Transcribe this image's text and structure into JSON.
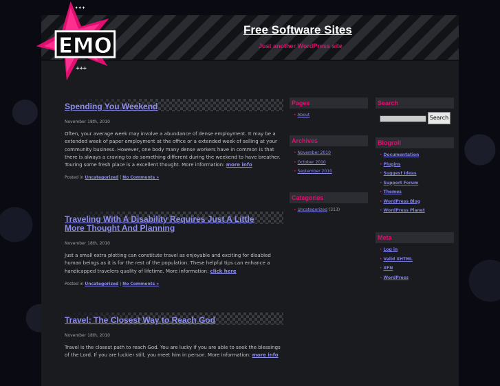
{
  "header": {
    "site_title": "Free Software Sites",
    "site_description": "Just another WordPress site",
    "logo_text": "EMO"
  },
  "posts": [
    {
      "title": "Spending You Weekend",
      "date": "November 18th, 2010",
      "body": "Often, your average week may involve a abundance of dense employment. It may be a extended week of paper employment at the office or a extended week of selling at your community business. However, one body many dense workers have in common is that there is always a craving to do something different during the weekend to have breather. Touring some fresh place is a excellent thought. More information: ",
      "more_link": "more info",
      "posted_in": "Posted in ",
      "category": "Uncategorized",
      "separator": " | ",
      "comments": "No Comments »"
    },
    {
      "title": "Traveling With A Disability Requires Just A Little More Thought And Planning",
      "date": "November 18th, 2010",
      "body": "Just a small extra plotting can constitute travel as enjoyable and exciting for disabled human beings as it is for the rest of the population. These helpful tips can enhance a handicapped travelers quality of lifetime. More information: ",
      "more_link": "click here",
      "posted_in": "Posted in ",
      "category": "Uncategorized",
      "separator": " | ",
      "comments": "No Comments »"
    },
    {
      "title": "Travel: The Closest Way to Reach God",
      "date": "November 18th, 2010",
      "body": "Travel is the closest path to reach God. You are lucky if you are able to seek the blessings of the Lord. If you are luckier still, you meet him in person. More information: ",
      "more_link": "more info"
    }
  ],
  "sidebar_left": {
    "pages": {
      "heading": "Pages",
      "items": [
        "About"
      ]
    },
    "archives": {
      "heading": "Archives",
      "items": [
        "November 2010",
        "October 2010",
        "September 2010"
      ]
    },
    "categories": {
      "heading": "Categories",
      "item": "Uncategorized",
      "count": "(313)"
    }
  },
  "sidebar_right": {
    "search": {
      "heading": "Search",
      "button": "Search",
      "value": ""
    },
    "blogroll": {
      "heading": "Blogroll",
      "items": [
        "Documentation",
        "Plugins",
        "Suggest Ideas",
        "Support Forum",
        "Themes",
        "WordPress Blog",
        "WordPress Planet"
      ]
    },
    "meta": {
      "heading": "Meta",
      "items": [
        "Log in",
        "Valid XHTML",
        "XFN",
        "WordPress"
      ]
    }
  },
  "colors": {
    "accent": "#e01070",
    "link": "#8d8df0",
    "background": "#1a1b1f"
  }
}
